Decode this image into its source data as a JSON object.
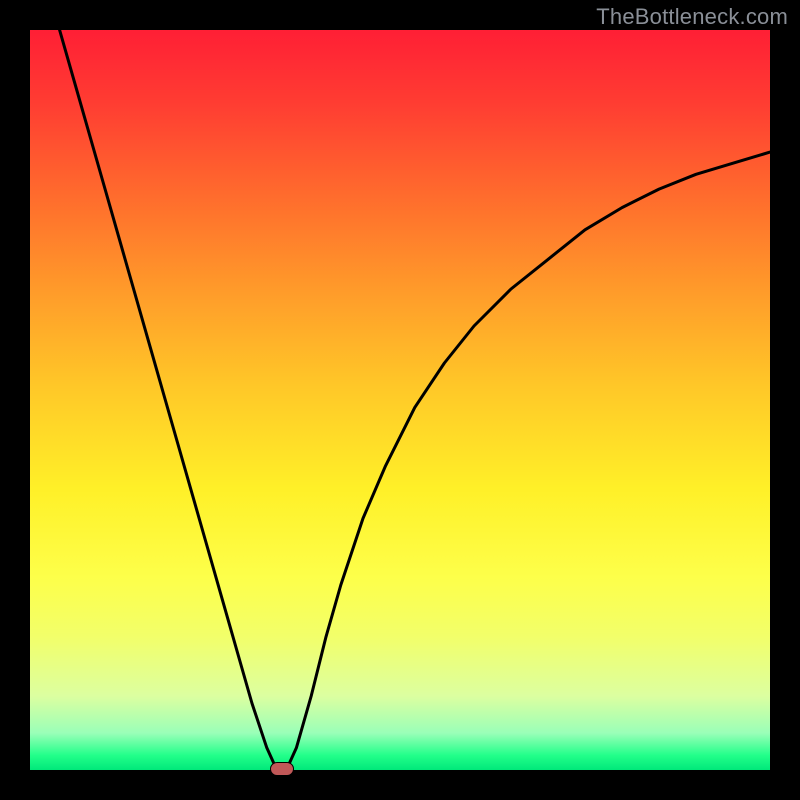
{
  "watermark": "TheBottleneck.com",
  "chart_data": {
    "type": "line",
    "title": "",
    "xlabel": "",
    "ylabel": "",
    "xlim": [
      0,
      100
    ],
    "ylim": [
      0,
      100
    ],
    "grid": false,
    "series": [
      {
        "name": "bottleneck-curve",
        "x": [
          4,
          6,
          8,
          10,
          12,
          14,
          16,
          18,
          20,
          22,
          24,
          26,
          28,
          30,
          32,
          33,
          34,
          35,
          36,
          38,
          40,
          42,
          45,
          48,
          52,
          56,
          60,
          65,
          70,
          75,
          80,
          85,
          90,
          95,
          100
        ],
        "values": [
          100,
          93,
          86,
          79,
          72,
          65,
          58,
          51,
          44,
          37,
          30,
          23,
          16,
          9,
          3,
          0.8,
          0.2,
          0.8,
          3,
          10,
          18,
          25,
          34,
          41,
          49,
          55,
          60,
          65,
          69,
          73,
          76,
          78.5,
          80.5,
          82,
          83.5
        ]
      }
    ],
    "marker": {
      "x": 34,
      "y": 0.2,
      "color": "#c05858"
    },
    "background_gradient": {
      "top": "#ff1f35",
      "mid": "#fff028",
      "bottom": "#00e87a"
    }
  }
}
